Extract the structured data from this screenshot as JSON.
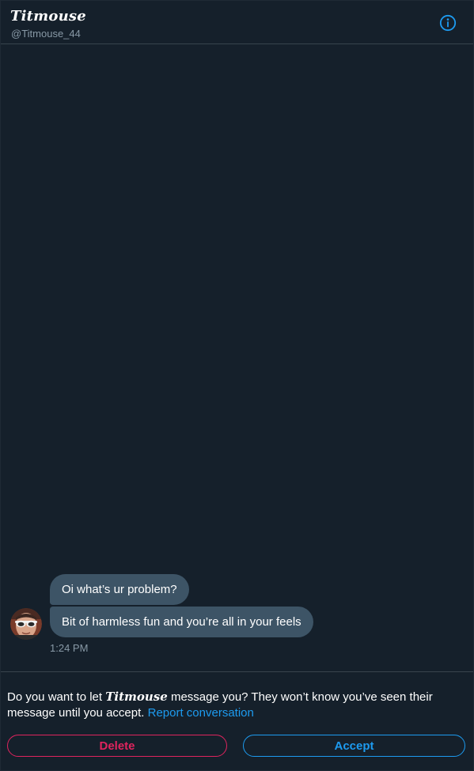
{
  "header": {
    "title": "Titmouse",
    "handle": "@Titmouse_44",
    "info_icon": "info-circle-icon"
  },
  "conversation": {
    "messages": [
      {
        "text": "Oi what’s ur problem?"
      },
      {
        "text": "Bit of harmless fun and you’re all in your feels"
      }
    ],
    "timestamp": "1:24 PM",
    "avatar_icon": "avatar-sunglasses"
  },
  "request": {
    "prompt_prefix": "Do you want to let ",
    "name": "Titmouse",
    "prompt_suffix": " message you? They won’t know you’ve seen their message until you accept. ",
    "report_link": "Report conversation",
    "delete_label": "Delete",
    "accept_label": "Accept"
  },
  "colors": {
    "background": "#15202b",
    "bubble": "#3d5466",
    "accent": "#1d9bf0",
    "danger": "#e0245e",
    "secondary_text": "#8899a6"
  }
}
